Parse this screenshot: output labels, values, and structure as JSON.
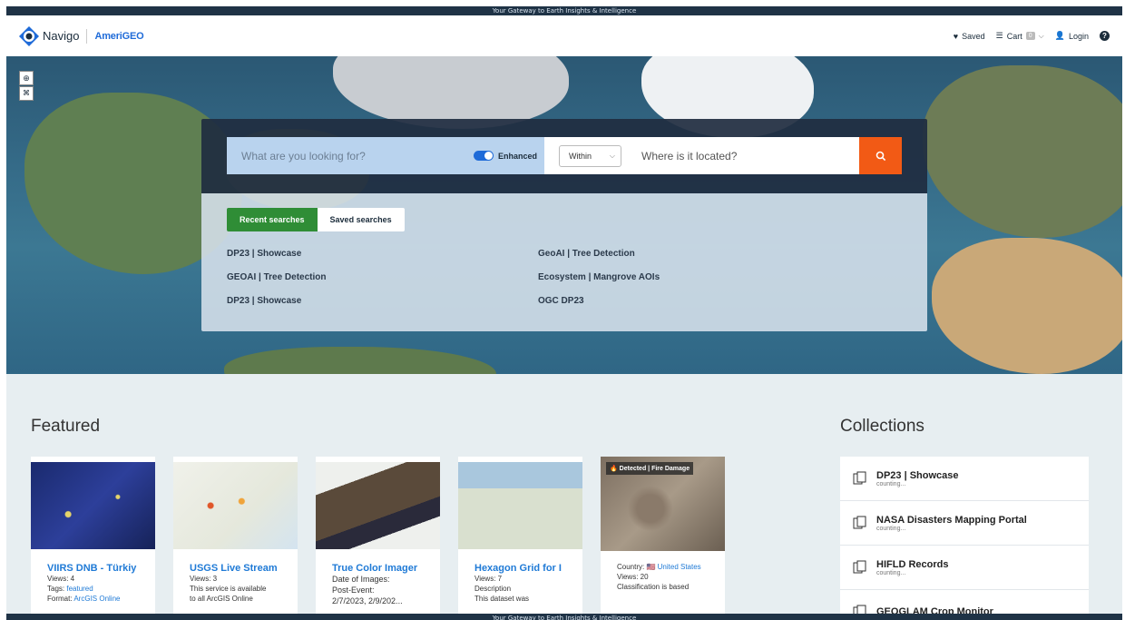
{
  "banner": {
    "text": "Your Gateway to Earth Insights & Intelligence"
  },
  "header": {
    "brand": "Navigo",
    "sub_brand": "AmeriGEO",
    "saved_label": "Saved",
    "cart_label": "Cart",
    "cart_count": "0",
    "login_label": "Login"
  },
  "search": {
    "what_placeholder": "What are you looking for?",
    "enhanced_label": "Enhanced",
    "within_label": "Within",
    "where_placeholder": "Where is it located?"
  },
  "tabs": {
    "recent": "Recent searches",
    "saved": "Saved searches"
  },
  "recent_searches": {
    "left": [
      "DP23 | Showcase",
      "GEOAI | Tree Detection",
      "DP23 | Showcase"
    ],
    "right": [
      "GeoAI | Tree Detection",
      "Ecosystem | Mangrove AOIs",
      "OGC DP23"
    ]
  },
  "featured": {
    "title": "Featured",
    "cards": [
      {
        "title": "VIIRS DNB - Türkiy",
        "lines": [
          [
            "Views: 4",
            ""
          ],
          [
            "Tags: ",
            "featured"
          ],
          [
            "Format: ",
            "ArcGIS Online"
          ]
        ]
      },
      {
        "title": "USGS Live Stream",
        "lines": [
          [
            "Views: 3",
            ""
          ],
          [
            "This service is available",
            ""
          ],
          [
            "to all ArcGIS Online",
            ""
          ]
        ]
      },
      {
        "title": "True Color Imager",
        "lines": [
          [
            "Date of Images:",
            ""
          ],
          [
            "Post-Event:",
            ""
          ],
          [
            "2/7/2023, 2/9/202...",
            ""
          ]
        ]
      },
      {
        "title": "Hexagon Grid for I",
        "lines": [
          [
            "Views: 7",
            ""
          ],
          [
            "Description",
            ""
          ],
          [
            "This dataset was",
            ""
          ]
        ]
      },
      {
        "title": "",
        "badge": "🔥 Detected | Fire Damage",
        "lines": [
          [
            "Country: 🇺🇸 ",
            "United States"
          ],
          [
            "Views: 20",
            ""
          ],
          [
            "Classification is based",
            ""
          ]
        ]
      }
    ]
  },
  "collections": {
    "title": "Collections",
    "items": [
      {
        "name": "DP23 | Showcase",
        "sub": "counting..."
      },
      {
        "name": "NASA Disasters Mapping Portal",
        "sub": "counting..."
      },
      {
        "name": "HIFLD Records",
        "sub": "counting..."
      },
      {
        "name": "GEOGLAM Crop Monitor",
        "sub": ""
      }
    ]
  },
  "colors": {
    "accent_orange": "#f25a15",
    "accent_green": "#2f8d36",
    "link_blue": "#1f7ad6",
    "banner_navy": "#1f3346"
  }
}
